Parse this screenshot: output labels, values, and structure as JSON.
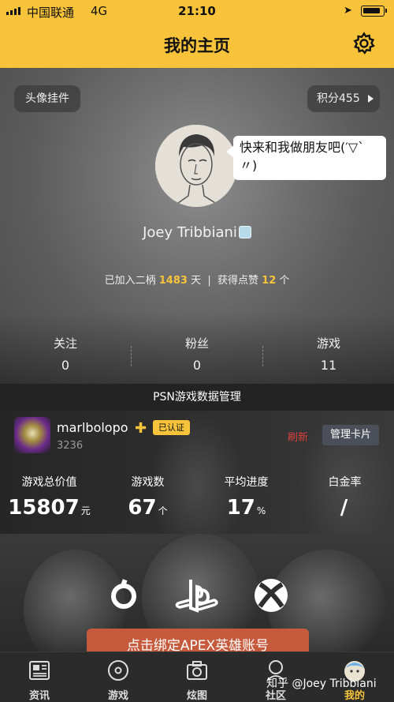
{
  "status_bar": {
    "carrier": "中国联通",
    "network": "4G",
    "time": "21:10"
  },
  "header": {
    "title": "我的主页",
    "settings_icon": "gear-icon"
  },
  "profile": {
    "avatar_frame_label": "头像挂件",
    "points_label": "积分455",
    "speech_bubble": "快来和我做朋友吧(′▽`〃)",
    "username": "Joey Tribbiani",
    "joined_prefix": "已加入二柄",
    "joined_days": "1483",
    "joined_unit": "天",
    "separator": "|",
    "likes_prefix": "获得点赞",
    "likes_count": "12",
    "likes_unit": "个",
    "stats": [
      {
        "label": "关注",
        "value": "0"
      },
      {
        "label": "粉丝",
        "value": "0"
      },
      {
        "label": "游戏",
        "value": "11"
      }
    ]
  },
  "psn": {
    "section_title": "PSN游戏数据管理",
    "account_name": "marlbolopo",
    "plus_icon": "plus-icon",
    "verified_label": "已认证",
    "account_id": "3236",
    "refresh_label": "刷新",
    "manage_label": "管理卡片",
    "metrics": [
      {
        "label": "游戏总价值",
        "value": "15807",
        "unit": "元"
      },
      {
        "label": "游戏数",
        "value": "67",
        "unit": "个"
      },
      {
        "label": "平均进度",
        "value": "17",
        "unit": "%"
      },
      {
        "label": "白金率",
        "value": "/",
        "unit": ""
      }
    ]
  },
  "banner": {
    "platform_icons": [
      "origin-icon",
      "playstation-icon",
      "xbox-icon"
    ],
    "apex_button_label": "点击绑定APEX英雄账号"
  },
  "tabbar": {
    "items": [
      {
        "label": "资讯",
        "icon": "news-icon"
      },
      {
        "label": "游戏",
        "icon": "disc-icon"
      },
      {
        "label": "炫图",
        "icon": "camera-icon"
      },
      {
        "label": "社区",
        "icon": "community-icon"
      },
      {
        "label": "我的",
        "icon": "profile-avatar-icon"
      }
    ],
    "active_index": 4
  },
  "watermark": "知乎 @Joey Tribbiani",
  "colors": {
    "accent": "#f6c33b",
    "refresh": "#d9403c",
    "apex_button": "#c65a3c"
  }
}
